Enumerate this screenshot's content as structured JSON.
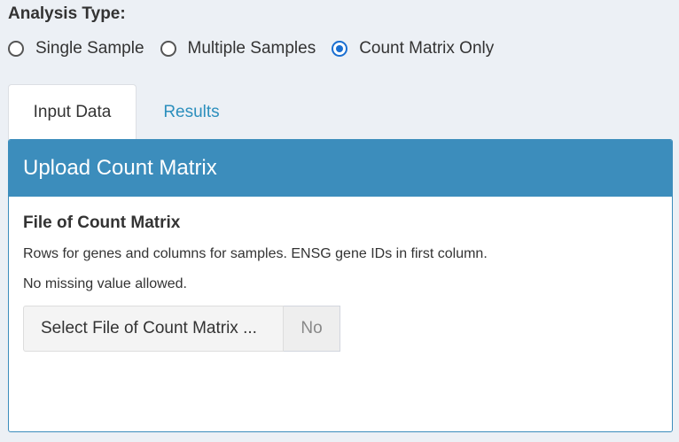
{
  "analysis_type": {
    "label": "Analysis Type:",
    "options": [
      {
        "label": "Single Sample",
        "checked": false
      },
      {
        "label": "Multiple Samples",
        "checked": false
      },
      {
        "label": "Count Matrix Only",
        "checked": true
      }
    ]
  },
  "tabs": [
    {
      "label": "Input Data",
      "active": true
    },
    {
      "label": "Results",
      "active": false
    }
  ],
  "panel": {
    "title": "Upload Count Matrix",
    "field_label": "File of Count Matrix",
    "help_line_1": "Rows for genes and columns for samples. ENSG gene IDs in first column.",
    "help_line_2": "No missing value allowed.",
    "file_button_label": "Select File of Count Matrix ...",
    "file_status": "No"
  },
  "colors": {
    "header_blue": "#3c8dbc",
    "page_background": "#ecf0f5",
    "radio_selected": "#1a6fd1",
    "tab_link": "#2c8fbd"
  }
}
